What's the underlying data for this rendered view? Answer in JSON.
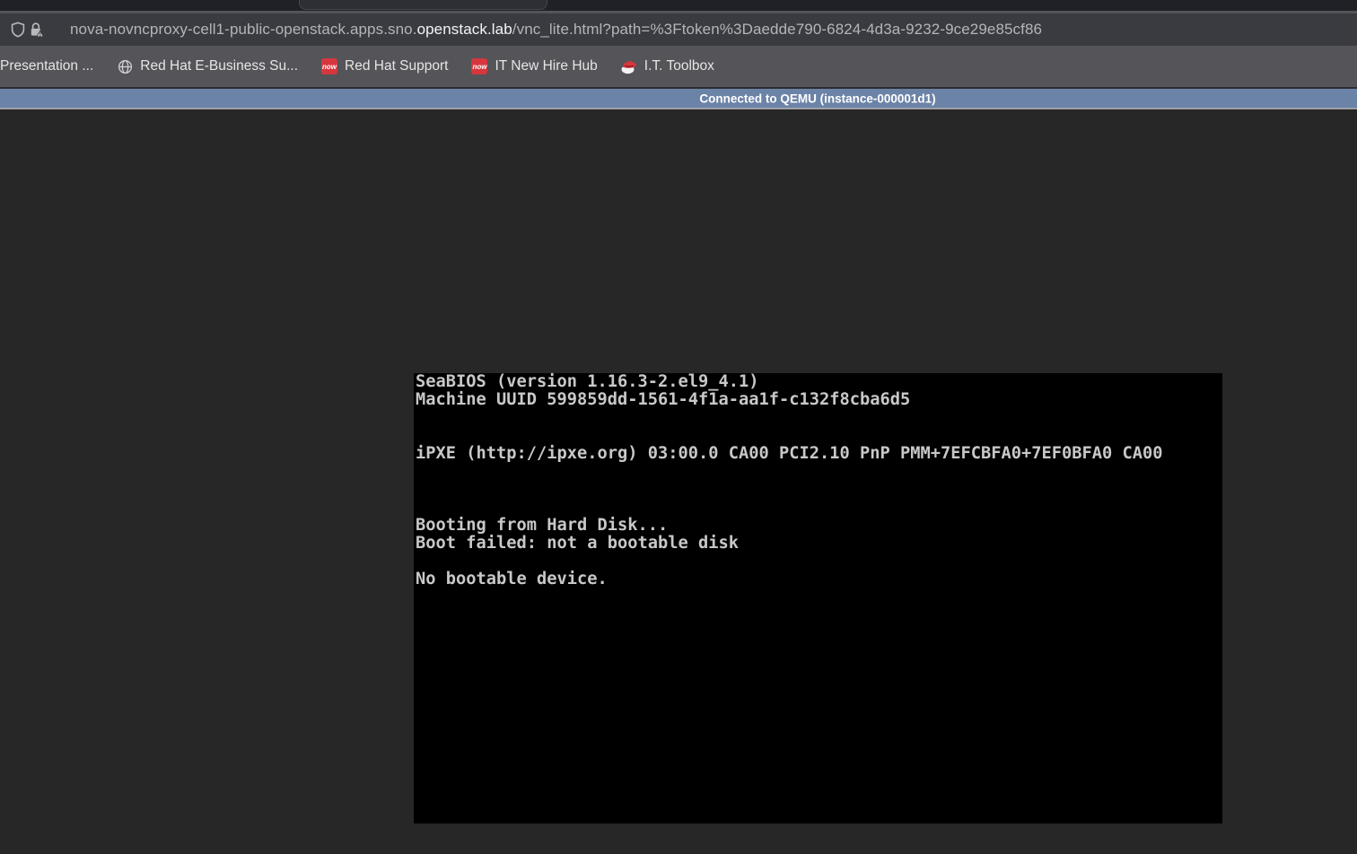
{
  "browser": {
    "url": {
      "prefix": "nova-novncproxy-cell1-public-openstack.apps.sno.",
      "domain": "openstack.lab",
      "suffix": "/vnc_lite.html?path=%3Ftoken%3Daedde790-6824-4d3a-9232-9ce29e85cf86"
    },
    "security": {
      "shield_icon": "tracking-protection-shield",
      "lock_icon": "connection-not-secure-lock-warning"
    },
    "bookmarks": [
      {
        "label": "Presentation ...",
        "icon": "none"
      },
      {
        "label": "Red Hat E-Business Su...",
        "icon": "globe"
      },
      {
        "label": "Red Hat Support",
        "icon": "servicenow-now-badge"
      },
      {
        "label": "IT New Hire Hub",
        "icon": "servicenow-now-badge"
      },
      {
        "label": "I.T. Toolbox",
        "icon": "redhat-fedora"
      }
    ],
    "now_badge_text": "now"
  },
  "vnc": {
    "status": "Connected to QEMU (instance-000001d1)",
    "console_text": "SeaBIOS (version 1.16.3-2.el9_4.1)\nMachine UUID 599859dd-1561-4f1a-aa1f-c132f8cba6d5\n\n\niPXE (http://ipxe.org) 03:00.0 CA00 PCI2.10 PnP PMM+7EFCBFA0+7EF0BFA0 CA00\n\n\n\nBooting from Hard Disk...\nBoot failed: not a bootable disk\n\nNo bootable device."
  },
  "colors": {
    "status_bar": "#6b83a7",
    "status_border": "#9fa0a6",
    "page_background": "#272727",
    "console_background": "#000000",
    "console_text": "#c8c8c8",
    "toolbar": "#545459",
    "urlbar": "#3a3b41",
    "now_badge_red": "#d6373c"
  }
}
